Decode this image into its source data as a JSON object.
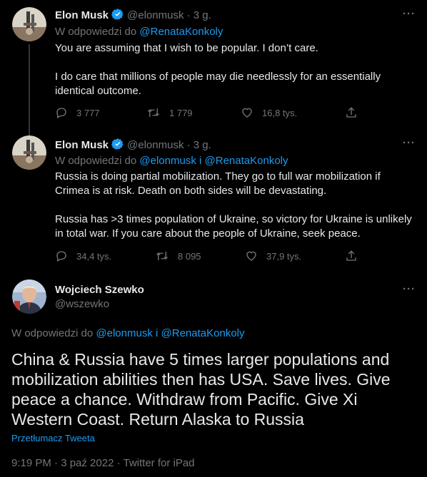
{
  "tweets": [
    {
      "name": "Elon Musk",
      "handle": "@elonmusk",
      "dot": "·",
      "time": "3 g.",
      "reply_prefix": "W odpowiedzi do",
      "reply_users": "@RenataKonkoly",
      "text_lines": [
        "You are assuming that I wish to be popular. I don’t care.",
        "",
        "I do care that millions of people may die needlessly for an essentially",
        "identical outcome."
      ],
      "replies": "3 777",
      "retweets": "1 779",
      "likes": "16,8 tys."
    },
    {
      "name": "Elon Musk",
      "handle": "@elonmusk",
      "dot": "·",
      "time": "3 g.",
      "reply_prefix": "W odpowiedzi do",
      "reply_users_1": "@elonmusk",
      "reply_and": "i",
      "reply_users_2": "@RenataKonkoly",
      "text_lines": [
        "Russia is doing partial mobilization. They go to full war mobilization if",
        "Crimea is at risk. Death on both sides will be devastating.",
        "",
        "Russia has >3 times population of Ukraine, so victory for Ukraine is unlikely",
        "in total war. If you care about the people of Ukraine, seek peace."
      ],
      "replies": "34,4 tys.",
      "retweets": "8 095",
      "likes": "37,9 tys."
    }
  ],
  "main": {
    "name": "Wojciech Szewko",
    "handle": "@wszewko",
    "reply_prefix": "W odpowiedzi do",
    "reply_users_1": "@elonmusk",
    "reply_and": "i",
    "reply_users_2": "@RenataKonkoly",
    "text_lines": [
      "China & Russia have 5 times larger populations and",
      "mobilization abilities then has USA. Save lives. Give",
      "peace a chance. Withdraw from Pacific. Give Xi",
      "Western Coast. Return Alaska to Russia"
    ],
    "translate": "Przetłumacz Tweeta",
    "timestamp": "9:19 PM · 3 paź 2022 · Twitter for iPad"
  },
  "more_label": "···",
  "colors": {
    "background": "#000000",
    "text": "#e7e9ea",
    "muted": "#71767b",
    "link": "#1d9bf0",
    "verified": "#1d9bf0"
  },
  "icons": [
    "verified-badge-icon",
    "reply-icon",
    "retweet-icon",
    "like-icon",
    "share-icon",
    "more-icon"
  ]
}
